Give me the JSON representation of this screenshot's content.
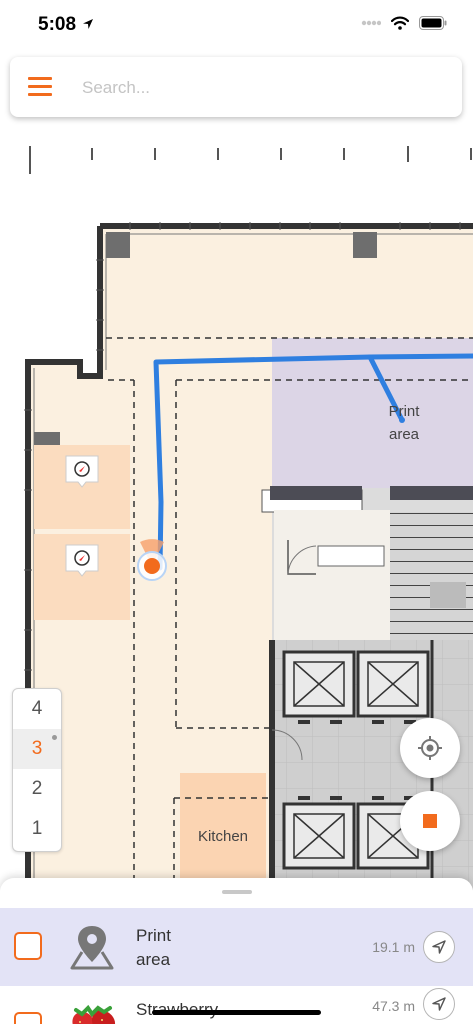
{
  "status_bar": {
    "time": "5:08"
  },
  "search": {
    "placeholder": "Search..."
  },
  "map": {
    "labels": {
      "print_area": [
        "Print",
        "area"
      ],
      "kitchen": "Kitchen"
    }
  },
  "floor_picker": {
    "floors": [
      "4",
      "3",
      "2",
      "1"
    ],
    "selected": "3"
  },
  "places": [
    {
      "title": [
        "Print",
        "area"
      ],
      "distance": "19.1 m"
    },
    {
      "title": [
        "Strawberry"
      ],
      "distance": "47.3 m"
    }
  ],
  "colors": {
    "accent": "#f26b1d",
    "route": "#2f7fe0",
    "floor_fill": "#fbf0e0",
    "print_area": "#dcd5e6"
  }
}
